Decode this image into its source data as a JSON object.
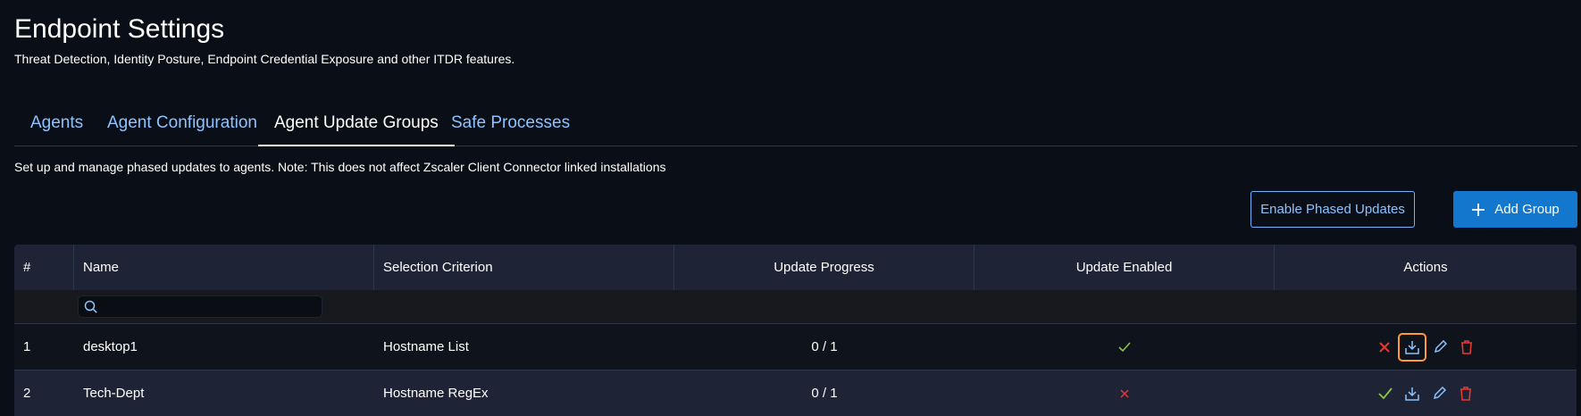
{
  "page": {
    "title": "Endpoint Settings",
    "subtitle": "Threat Detection, Identity Posture, Endpoint Credential Exposure and other ITDR features."
  },
  "tabs": [
    {
      "label": "Agents",
      "active": false
    },
    {
      "label": "Agent Configuration",
      "active": false
    },
    {
      "label": "Agent Update Groups",
      "active": true
    },
    {
      "label": "Safe Processes",
      "active": false
    }
  ],
  "description": "Set up and manage phased updates to agents. Note: This does not affect Zscaler Client Connector linked installations",
  "buttons": {
    "enable_phased": "Enable Phased Updates",
    "add_group": "Add Group"
  },
  "table": {
    "columns": [
      "#",
      "Name",
      "Selection Criterion",
      "Update Progress",
      "Update Enabled",
      "Actions"
    ],
    "search_placeholder": "",
    "rows": [
      {
        "index": "1",
        "name": "desktop1",
        "criterion": "Hostname List",
        "progress": "0 / 1",
        "enabled": false
      },
      {
        "index": "2",
        "name": "Tech-Dept",
        "criterion": "Hostname RegEx",
        "progress": "0 / 1",
        "enabled": false
      }
    ]
  },
  "colors": {
    "accent": "#1378cd",
    "link": "#8cc3ff",
    "success": "#8bc34a",
    "danger": "#e53935",
    "focus": "#ff9a3c"
  }
}
